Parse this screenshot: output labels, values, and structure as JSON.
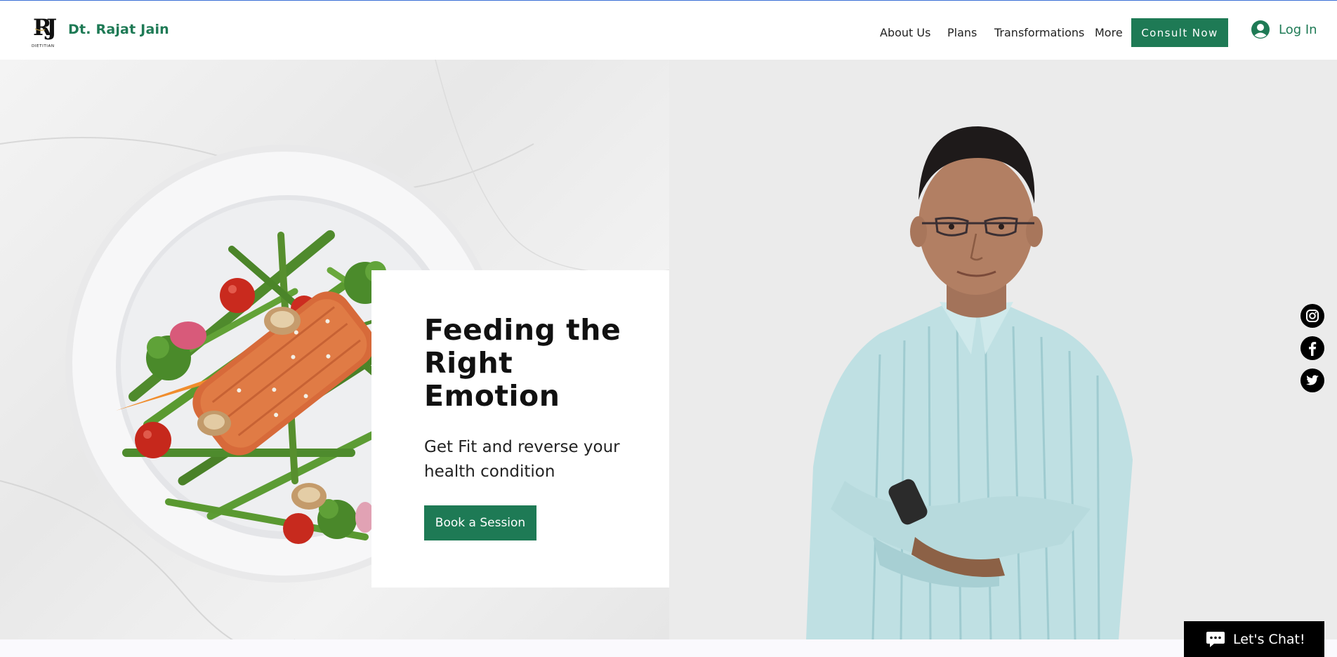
{
  "header": {
    "logo_text": "RJ",
    "logo_sub": "DIETITIAN",
    "brand_name": "Dt. Rajat Jain",
    "nav": [
      "About Us",
      "Plans",
      "Transformations",
      "More"
    ],
    "consult_label": "Consult Now",
    "login_label": "Log In",
    "login_icon": "account-circle-icon"
  },
  "hero": {
    "headline": "Feeding the Right Emotion",
    "subhead": "Get Fit and reverse your health condition",
    "cta_label": "Book a Session"
  },
  "socials": [
    "instagram-icon",
    "facebook-icon",
    "twitter-icon"
  ],
  "chat": {
    "label": "Let's Chat!",
    "icon": "chat-bubble-icon"
  },
  "colors": {
    "brand_green": "#1e7a55",
    "topline_blue": "#3b6fd6",
    "social_black": "#000000"
  }
}
